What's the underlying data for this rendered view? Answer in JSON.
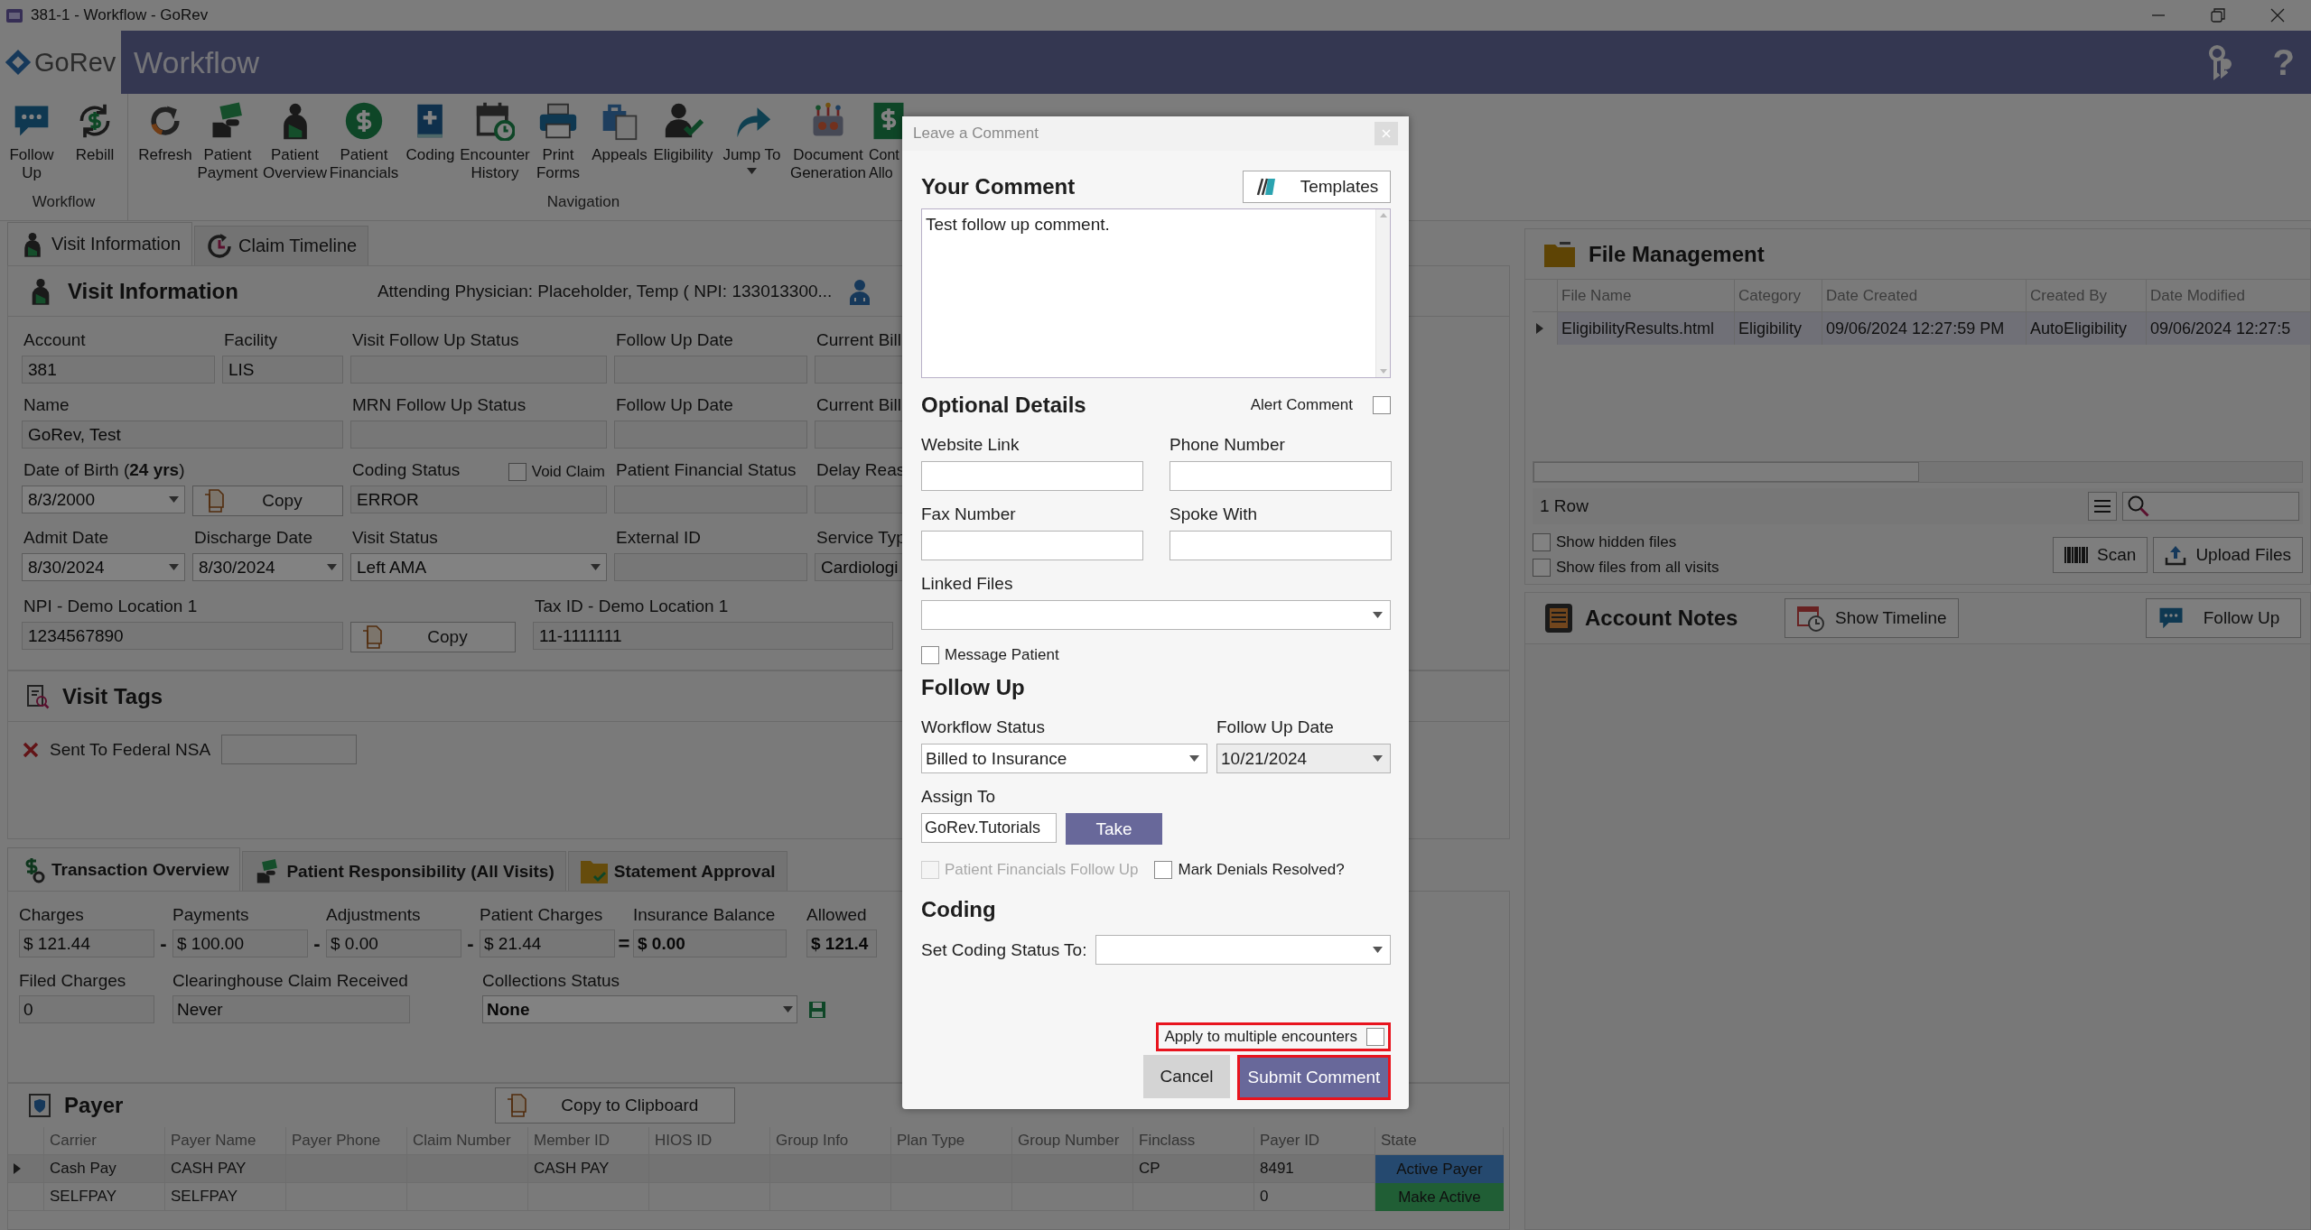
{
  "window": {
    "title": "381-1 - Workflow - GoRev"
  },
  "header": {
    "logo": "GoRev",
    "title": "Workflow",
    "help": "?"
  },
  "toolbar": {
    "groups": [
      {
        "label": "Workflow",
        "items": [
          {
            "label": "Follow\nUp",
            "menu": false
          },
          {
            "label": "Rebill",
            "menu": false
          }
        ]
      },
      {
        "label": "Navigation",
        "items": [
          {
            "label": "Refresh",
            "menu": false
          },
          {
            "label": "Patient\nPayment",
            "menu": false
          },
          {
            "label": "Patient\nOverview",
            "menu": false
          },
          {
            "label": "Patient\nFinancials",
            "menu": false
          },
          {
            "label": "Coding",
            "menu": false
          },
          {
            "label": "Encounter\nHistory",
            "menu": false
          },
          {
            "label": "Print\nForms",
            "menu": false
          },
          {
            "label": "Appeals",
            "menu": false
          },
          {
            "label": "Eligibility",
            "menu": false
          },
          {
            "label": "Jump To",
            "menu": true
          },
          {
            "label": "Document\nGeneration",
            "menu": false
          },
          {
            "label": "Cont\nAllo",
            "menu": false
          }
        ]
      }
    ]
  },
  "left_tabs": [
    {
      "label": "Visit Information",
      "selected": true
    },
    {
      "label": "Claim Timeline",
      "selected": false
    }
  ],
  "visit_information": {
    "title": "Visit Information",
    "attending": "Attending Physician: Placeholder, Temp ( NPI: 133013300...",
    "rows": [
      {
        "fields": [
          {
            "kind": "text",
            "label": "Account",
            "value": "381"
          },
          {
            "kind": "text",
            "label": "Facility",
            "value": "LIS"
          },
          {
            "kind": "text",
            "label": "Visit Follow Up Status"
          },
          {
            "kind": "text",
            "label": "Follow Up Date"
          },
          {
            "kind": "text",
            "label": "Current Bill"
          }
        ]
      },
      {
        "fields": [
          {
            "kind": "text",
            "label": "Name",
            "value": "GoRev, Test"
          },
          {
            "kind": "text",
            "label": "MRN Follow Up Status"
          },
          {
            "kind": "text",
            "label": "Follow Up Date"
          },
          {
            "kind": "text",
            "label": "Current Bill"
          }
        ]
      },
      {
        "fields": [
          {
            "kind": "dropdown",
            "label": "Date of Birth (**24 yrs**)",
            "value": "8/3/2000"
          },
          {
            "kind": "button",
            "text": "Copy"
          },
          {
            "kind": "text",
            "label": "Coding Status",
            "value": "ERROR",
            "checkbox": {
              "label": "Void Claim",
              "checked": false
            }
          },
          {
            "kind": "text",
            "label": "Patient Financial Status"
          },
          {
            "kind": "text",
            "label": "Delay Reas"
          }
        ]
      },
      {
        "fields": [
          {
            "kind": "dropdown",
            "label": "Admit Date",
            "value": "8/30/2024"
          },
          {
            "kind": "dropdown",
            "label": "Discharge Date",
            "value": "8/30/2024"
          },
          {
            "kind": "dropdown",
            "label": "Visit Status",
            "value": "Left AMA"
          },
          {
            "kind": "text",
            "label": "External ID"
          },
          {
            "kind": "text",
            "label": "Service Typ",
            "value": "Cardiologi"
          }
        ]
      }
    ],
    "location": [
      {
        "kind": "text",
        "label": "NPI - Demo Location 1",
        "value": "1234567890"
      },
      {
        "kind": "button",
        "text": "Copy"
      },
      {
        "kind": "text",
        "label": "Tax ID - Demo Location 1",
        "value": "11-1111111"
      }
    ]
  },
  "visit_tags": {
    "title": "Visit Tags",
    "tags": [
      {
        "label": "Sent To Federal NSA"
      }
    ]
  },
  "transaction_tabs": [
    {
      "label": "Transaction Overview",
      "selected": true
    },
    {
      "label": "Patient Responsibility (All Visits)",
      "selected": false
    },
    {
      "label": "Statement Approval",
      "selected": false
    }
  ],
  "transaction": {
    "totals": [
      {
        "label": "Charges",
        "value": "$ 121.44",
        "bold": false
      },
      {
        "operator": "-",
        "label": "Payments",
        "value": "$ 100.00",
        "bold": false
      },
      {
        "operator": "-",
        "label": "Adjustments",
        "value": "$ 0.00",
        "bold": false
      },
      {
        "operator": "-",
        "label": "Patient Charges",
        "value": "$ 21.44",
        "bold": false
      },
      {
        "operator": "=",
        "label": "Insurance Balance",
        "value": "$ 0.00",
        "bold": true
      },
      {
        "label": "Allowed",
        "value": "$ 121.4",
        "bold": true
      }
    ],
    "details": [
      {
        "label": "Filed Charges",
        "value": "0",
        "bold": false
      },
      {
        "label": "Clearinghouse Claim Received",
        "value": "Never",
        "bold": false
      },
      {
        "label": "Collections Status",
        "value": "None",
        "bold": true,
        "kind": "dropdown"
      }
    ]
  },
  "payer": {
    "title": "Payer",
    "copy_button": "Copy to Clipboard",
    "columns": [
      "Carrier",
      "Payer Name",
      "Payer Phone",
      "Claim Number",
      "Member ID",
      "HIOS ID",
      "Group Info",
      "Plan Type",
      "Group Number",
      "Finclass",
      "Payer ID",
      "State"
    ],
    "rows": [
      {
        "selected": true,
        "cells": [
          "Cash Pay",
          "CASH PAY",
          "",
          "",
          "CASH PAY",
          "",
          "",
          "",
          "",
          "CP",
          "8491"
        ],
        "state": {
          "label": "Active Payer",
          "kind": "active"
        }
      },
      {
        "selected": false,
        "cells": [
          "SELFPAY",
          "SELFPAY",
          "",
          "",
          "",
          "",
          "",
          "",
          "",
          "",
          "0"
        ],
        "state": {
          "label": "Make Active",
          "kind": "make-active"
        }
      }
    ]
  },
  "file_management": {
    "title": "File Management",
    "columns": [
      "File Name",
      "Category",
      "Date Created",
      "Created By",
      "Date Modified"
    ],
    "rows": [
      {
        "selected": true,
        "cells": [
          "EligibilityResults.html",
          "Eligibility",
          "09/06/2024 12:27:59 PM",
          "AutoEligibility",
          "09/06/2024 12:27:5"
        ]
      }
    ],
    "row_count": "1 Row",
    "checkboxes": [
      {
        "label": "Show hidden files",
        "checked": false
      },
      {
        "label": "Show files from all visits",
        "checked": false
      }
    ],
    "buttons": [
      "Scan",
      "Upload Files"
    ]
  },
  "account_notes": {
    "title": "Account Notes",
    "buttons": [
      "Show Timeline",
      "Follow Up"
    ]
  },
  "dialog": {
    "title": "Leave a Comment",
    "comment_heading": "Your Comment",
    "templates_button": "Templates",
    "comment": "Test follow up comment.",
    "optional_heading": "Optional Details",
    "alert_comment": {
      "label": "Alert Comment",
      "checked": false
    },
    "fields": [
      {
        "label": "Website Link"
      },
      {
        "label": "Phone Number"
      },
      {
        "label": "Fax Number"
      },
      {
        "label": "Spoke With"
      }
    ],
    "linked_files": {
      "label": "Linked Files"
    },
    "message_patient": {
      "label": "Message Patient",
      "checked": false
    },
    "follow_up_heading": "Follow Up",
    "workflow_status": {
      "label": "Workflow Status",
      "value": "Billed to Insurance"
    },
    "follow_up_date": {
      "label": "Follow Up Date",
      "value": "10/21/2024"
    },
    "assign_to": {
      "label": "Assign To",
      "value": "GoRev.Tutorials"
    },
    "take_button": "Take",
    "options": [
      {
        "label": "Patient Financials Follow Up",
        "checked": false,
        "disabled": true
      },
      {
        "label": "Mark Denials Resolved?",
        "checked": false,
        "disabled": false
      }
    ],
    "coding_heading": "Coding",
    "coding_status": {
      "label": "Set Coding Status To:"
    },
    "apply_multiple": {
      "label": "Apply to multiple encounters",
      "checked": false,
      "highlighted": true
    },
    "cancel_button": "Cancel",
    "submit_button": {
      "label": "Submit Comment",
      "highlighted": true
    }
  }
}
